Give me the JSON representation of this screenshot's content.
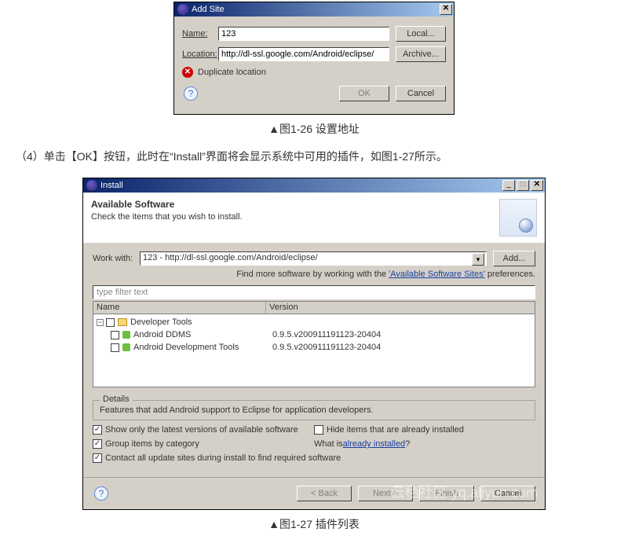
{
  "dialog1": {
    "title": "Add Site",
    "name_label": "Name:",
    "name_value": "123",
    "local_btn": "Local...",
    "location_label": "Location:",
    "location_value": "http://dl-ssl.google.com/Android/eclipse/",
    "archive_btn": "Archive...",
    "error_text": "Duplicate location",
    "ok_btn": "OK",
    "cancel_btn": "Cancel"
  },
  "caption1": "▲图1-26 设置地址",
  "body_text": "（4）单击【OK】按钮，此时在“Install”界面将会显示系统中可用的插件，如图1-27所示。",
  "dialog2": {
    "title": "Install",
    "banner_title": "Available Software",
    "banner_sub": "Check the items that you wish to install.",
    "workwith_label": "Work with:",
    "workwith_value": "123 - http://dl-ssl.google.com/Android/eclipse/",
    "add_btn": "Add...",
    "hint_prefix": "Find more software by working with the ",
    "hint_link": "'Available Software Sites'",
    "hint_suffix": " preferences.",
    "filter_placeholder": "type filter text",
    "col_name": "Name",
    "col_version": "Version",
    "cat_label": "Developer Tools",
    "items": [
      {
        "name": "Android DDMS",
        "version": "0.9.5.v200911191123-20404"
      },
      {
        "name": "Android Development Tools",
        "version": "0.9.5.v200911191123-20404"
      }
    ],
    "details_legend": "Details",
    "details_text": "Features that add Android support to Eclipse for application developers.",
    "chk_latest": "Show only the latest versions of available software",
    "chk_hide": "Hide items that are already installed",
    "chk_group": "Group items by category",
    "whatis_text": "What is ",
    "whatis_link": "already installed",
    "chk_contact": "Contact all update sites during install to find required software",
    "back_btn": "< Back",
    "next_btn": "Next >",
    "finish_btn": "Finish",
    "cancel_btn": "Cancel"
  },
  "caption2": "▲图1-27 插件列表",
  "watermark": "云栖社区  yq.aliyun.com"
}
